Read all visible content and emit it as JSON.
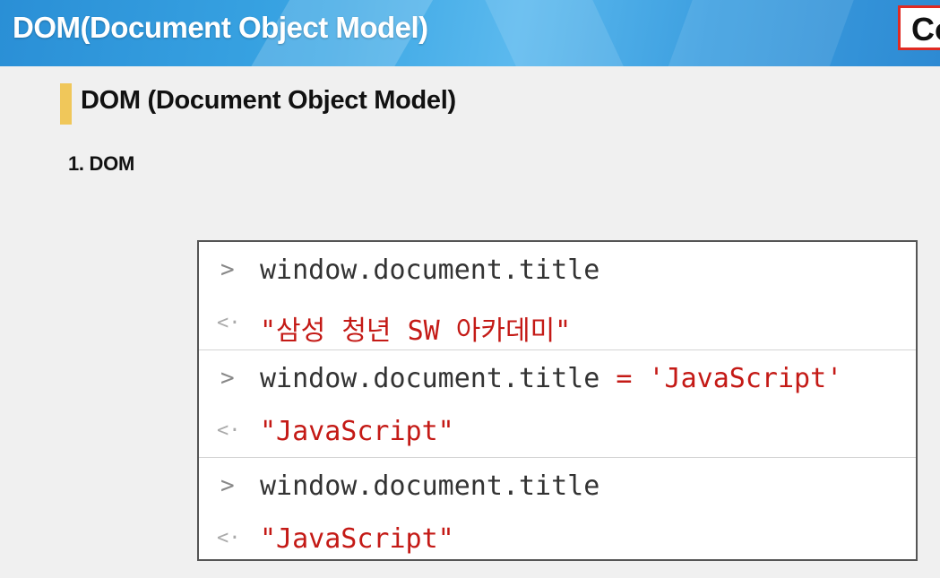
{
  "header": {
    "title": "DOM(Document Object Model)",
    "corner_text": "Co"
  },
  "section": {
    "title": "DOM (Document Object Model)",
    "subheading": "1. DOM"
  },
  "console": {
    "input_prompt_icon": "chevron-right-icon",
    "output_prompt_icon": "return-arrow-icon",
    "entries": [
      {
        "input": "window.document.title",
        "output": "\"삼성 청년 SW 아카데미\""
      },
      {
        "input_lhs": "window.document.title",
        "input_op": "=",
        "input_rhs": "'JavaScript'",
        "output": "\"JavaScript\""
      },
      {
        "input": "window.document.title",
        "output": "\"JavaScript\""
      }
    ],
    "prompt_input": ">",
    "prompt_output": "<·"
  },
  "colors": {
    "header_blue": "#3aa6e4",
    "accent_bar": "#f0c75a",
    "string_red": "#c41a16",
    "corner_border": "#e02a22"
  }
}
